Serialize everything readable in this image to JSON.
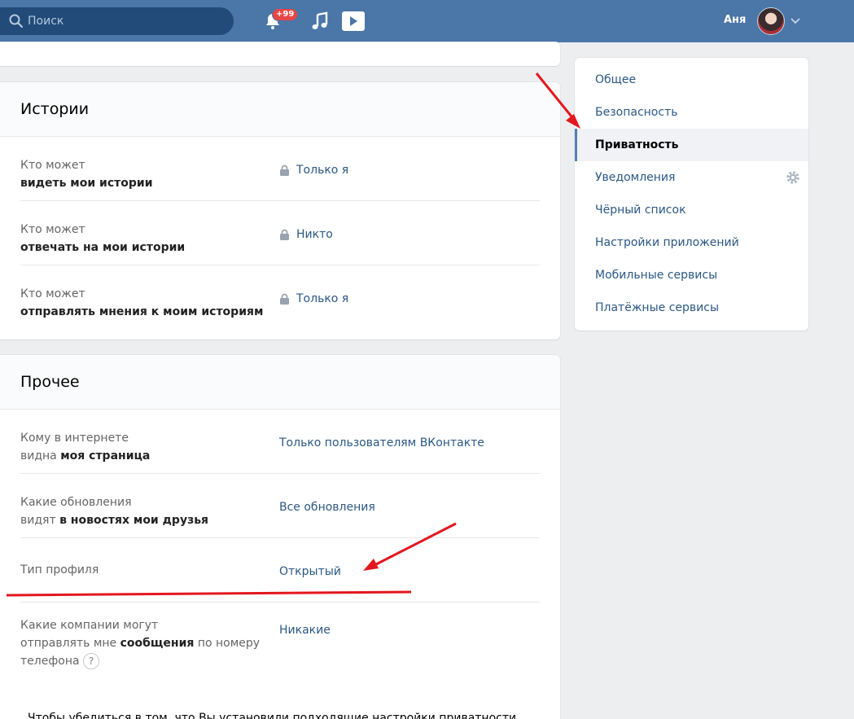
{
  "header": {
    "search_placeholder": "Поиск",
    "notification_badge": "+99",
    "user_name": "Аня"
  },
  "stories": {
    "title": "Истории",
    "rows": [
      {
        "line1": "Кто может",
        "line2": "видеть мои истории",
        "value": "Только я",
        "icon": "lock-icon"
      },
      {
        "line1": "Кто может",
        "line2": "отвечать на мои истории",
        "value": "Никто",
        "icon": "lock-icon"
      },
      {
        "line1": "Кто может",
        "line2": "отправлять мнения к моим историям",
        "value": "Только я",
        "icon": "lock-icon"
      }
    ]
  },
  "other": {
    "title": "Прочее",
    "row1": {
      "line1": "Кому в интернете",
      "line2_plain": "видна ",
      "line2_bold": "моя страница",
      "value": "Только пользователям ВКонтакте"
    },
    "row2": {
      "line1": "Какие обновления",
      "line2_plain": "видят ",
      "line2_bold": "в новостях мои друзья",
      "value": "Все обновления"
    },
    "row3": {
      "line1": "Тип профиля",
      "value": "Открытый"
    },
    "row4": {
      "line1": "Какие компании могут",
      "line2_plain": "отправлять мне ",
      "line2_bold": "сообщения",
      "line2_tail": " по номеру",
      "line3": "телефона",
      "help": "?",
      "value": "Никакие"
    },
    "footnote": "Чтобы убедиться в том, что Вы установили подходящие настройки приватности,"
  },
  "menu": {
    "items": [
      {
        "label": "Общее"
      },
      {
        "label": "Безопасность"
      },
      {
        "label": "Приватность"
      },
      {
        "label": "Уведомления"
      },
      {
        "label": "Чёрный список"
      },
      {
        "label": "Настройки приложений"
      },
      {
        "label": "Мобильные сервисы"
      },
      {
        "label": "Платёжные сервисы"
      }
    ]
  },
  "colors": {
    "header_bg": "#4a76a8",
    "link": "#2a5885",
    "annotation": "#e3171e"
  }
}
